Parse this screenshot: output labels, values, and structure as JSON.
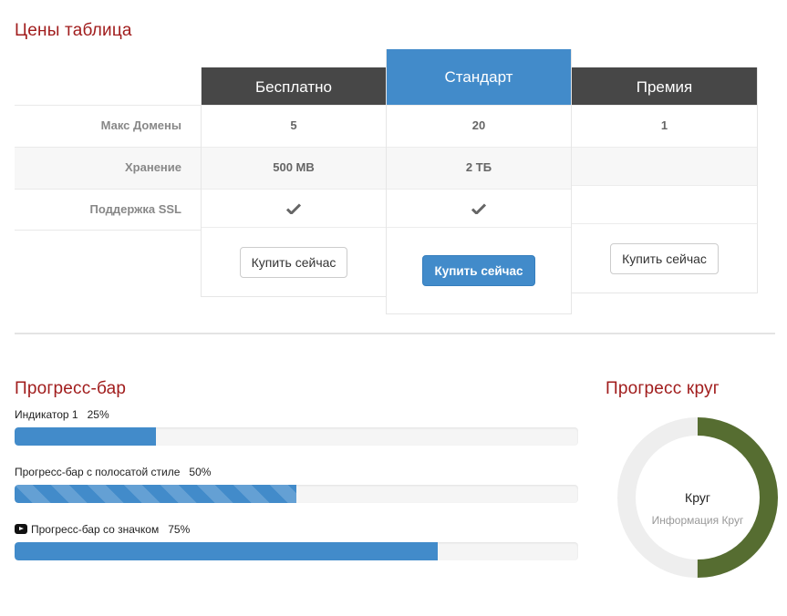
{
  "pricing": {
    "title": "Цены таблица",
    "features": [
      "Макс Домены",
      "Хранение",
      "Поддержка SSL"
    ],
    "plans": [
      {
        "name": "Бесплатно",
        "domains": "5",
        "storage": "500 MB",
        "ssl": true,
        "button": "Купить сейчас"
      },
      {
        "name": "Стандарт",
        "domains": "20",
        "storage": "2 ТБ",
        "ssl": true,
        "button": "Купить сейчас",
        "highlight_color": "#428bca"
      },
      {
        "name": "Премия",
        "domains": "1",
        "storage": "",
        "ssl": false,
        "button": "Купить сейчас"
      }
    ],
    "header_color": "#474747",
    "check_icon": "check-icon"
  },
  "progress": {
    "title": "Прогресс-бар",
    "bars": [
      {
        "label": "Индикатор 1",
        "percent_text": "25%",
        "value": 25,
        "style": "solid"
      },
      {
        "label": "Прогресс-бар с полосатой стиле",
        "percent_text": "50%",
        "value": 50,
        "style": "striped"
      },
      {
        "label": "Прогресс-бар со значком",
        "percent_text": "75%",
        "value": 75,
        "style": "solid",
        "icon": "youtube-icon"
      }
    ],
    "bar_color": "#428bca"
  },
  "circle": {
    "title": "Прогресс круг",
    "label": "Круг",
    "sublabel": "Информация Круг",
    "value": 50,
    "color": "#566d31",
    "track_color": "#eeeeee"
  },
  "accent_title_color": "#a11d1d"
}
